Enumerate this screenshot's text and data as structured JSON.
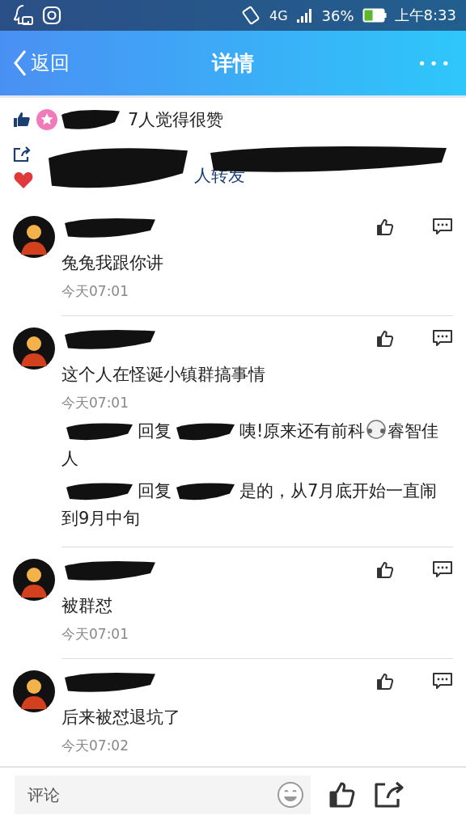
{
  "status_bar": {
    "battery": "36%",
    "time": "上午8:33",
    "network": "4G"
  },
  "header": {
    "back": "返回",
    "title": "详情",
    "more": "•••"
  },
  "likes": {
    "text": "7人觉得很赞"
  },
  "shares": {
    "text": "人转发"
  },
  "comments": [
    {
      "text": "兔兔我跟你讲",
      "time": "今天07:01"
    },
    {
      "text": "这个人在怪诞小镇群搞事情",
      "time": "今天07:01",
      "replies": [
        {
          "verb": "回复",
          "text": "咦!原来还有前科",
          "emoji": true,
          "text_after": "睿智佳人"
        },
        {
          "verb": "回复",
          "text": "是的，从7月底开始一直闹到9月中旬",
          "emoji": false
        }
      ]
    },
    {
      "text": "被群怼",
      "time": "今天07:01"
    },
    {
      "text": "后来被怼退坑了",
      "time": "今天07:02"
    }
  ],
  "composer": {
    "placeholder": "评论"
  }
}
